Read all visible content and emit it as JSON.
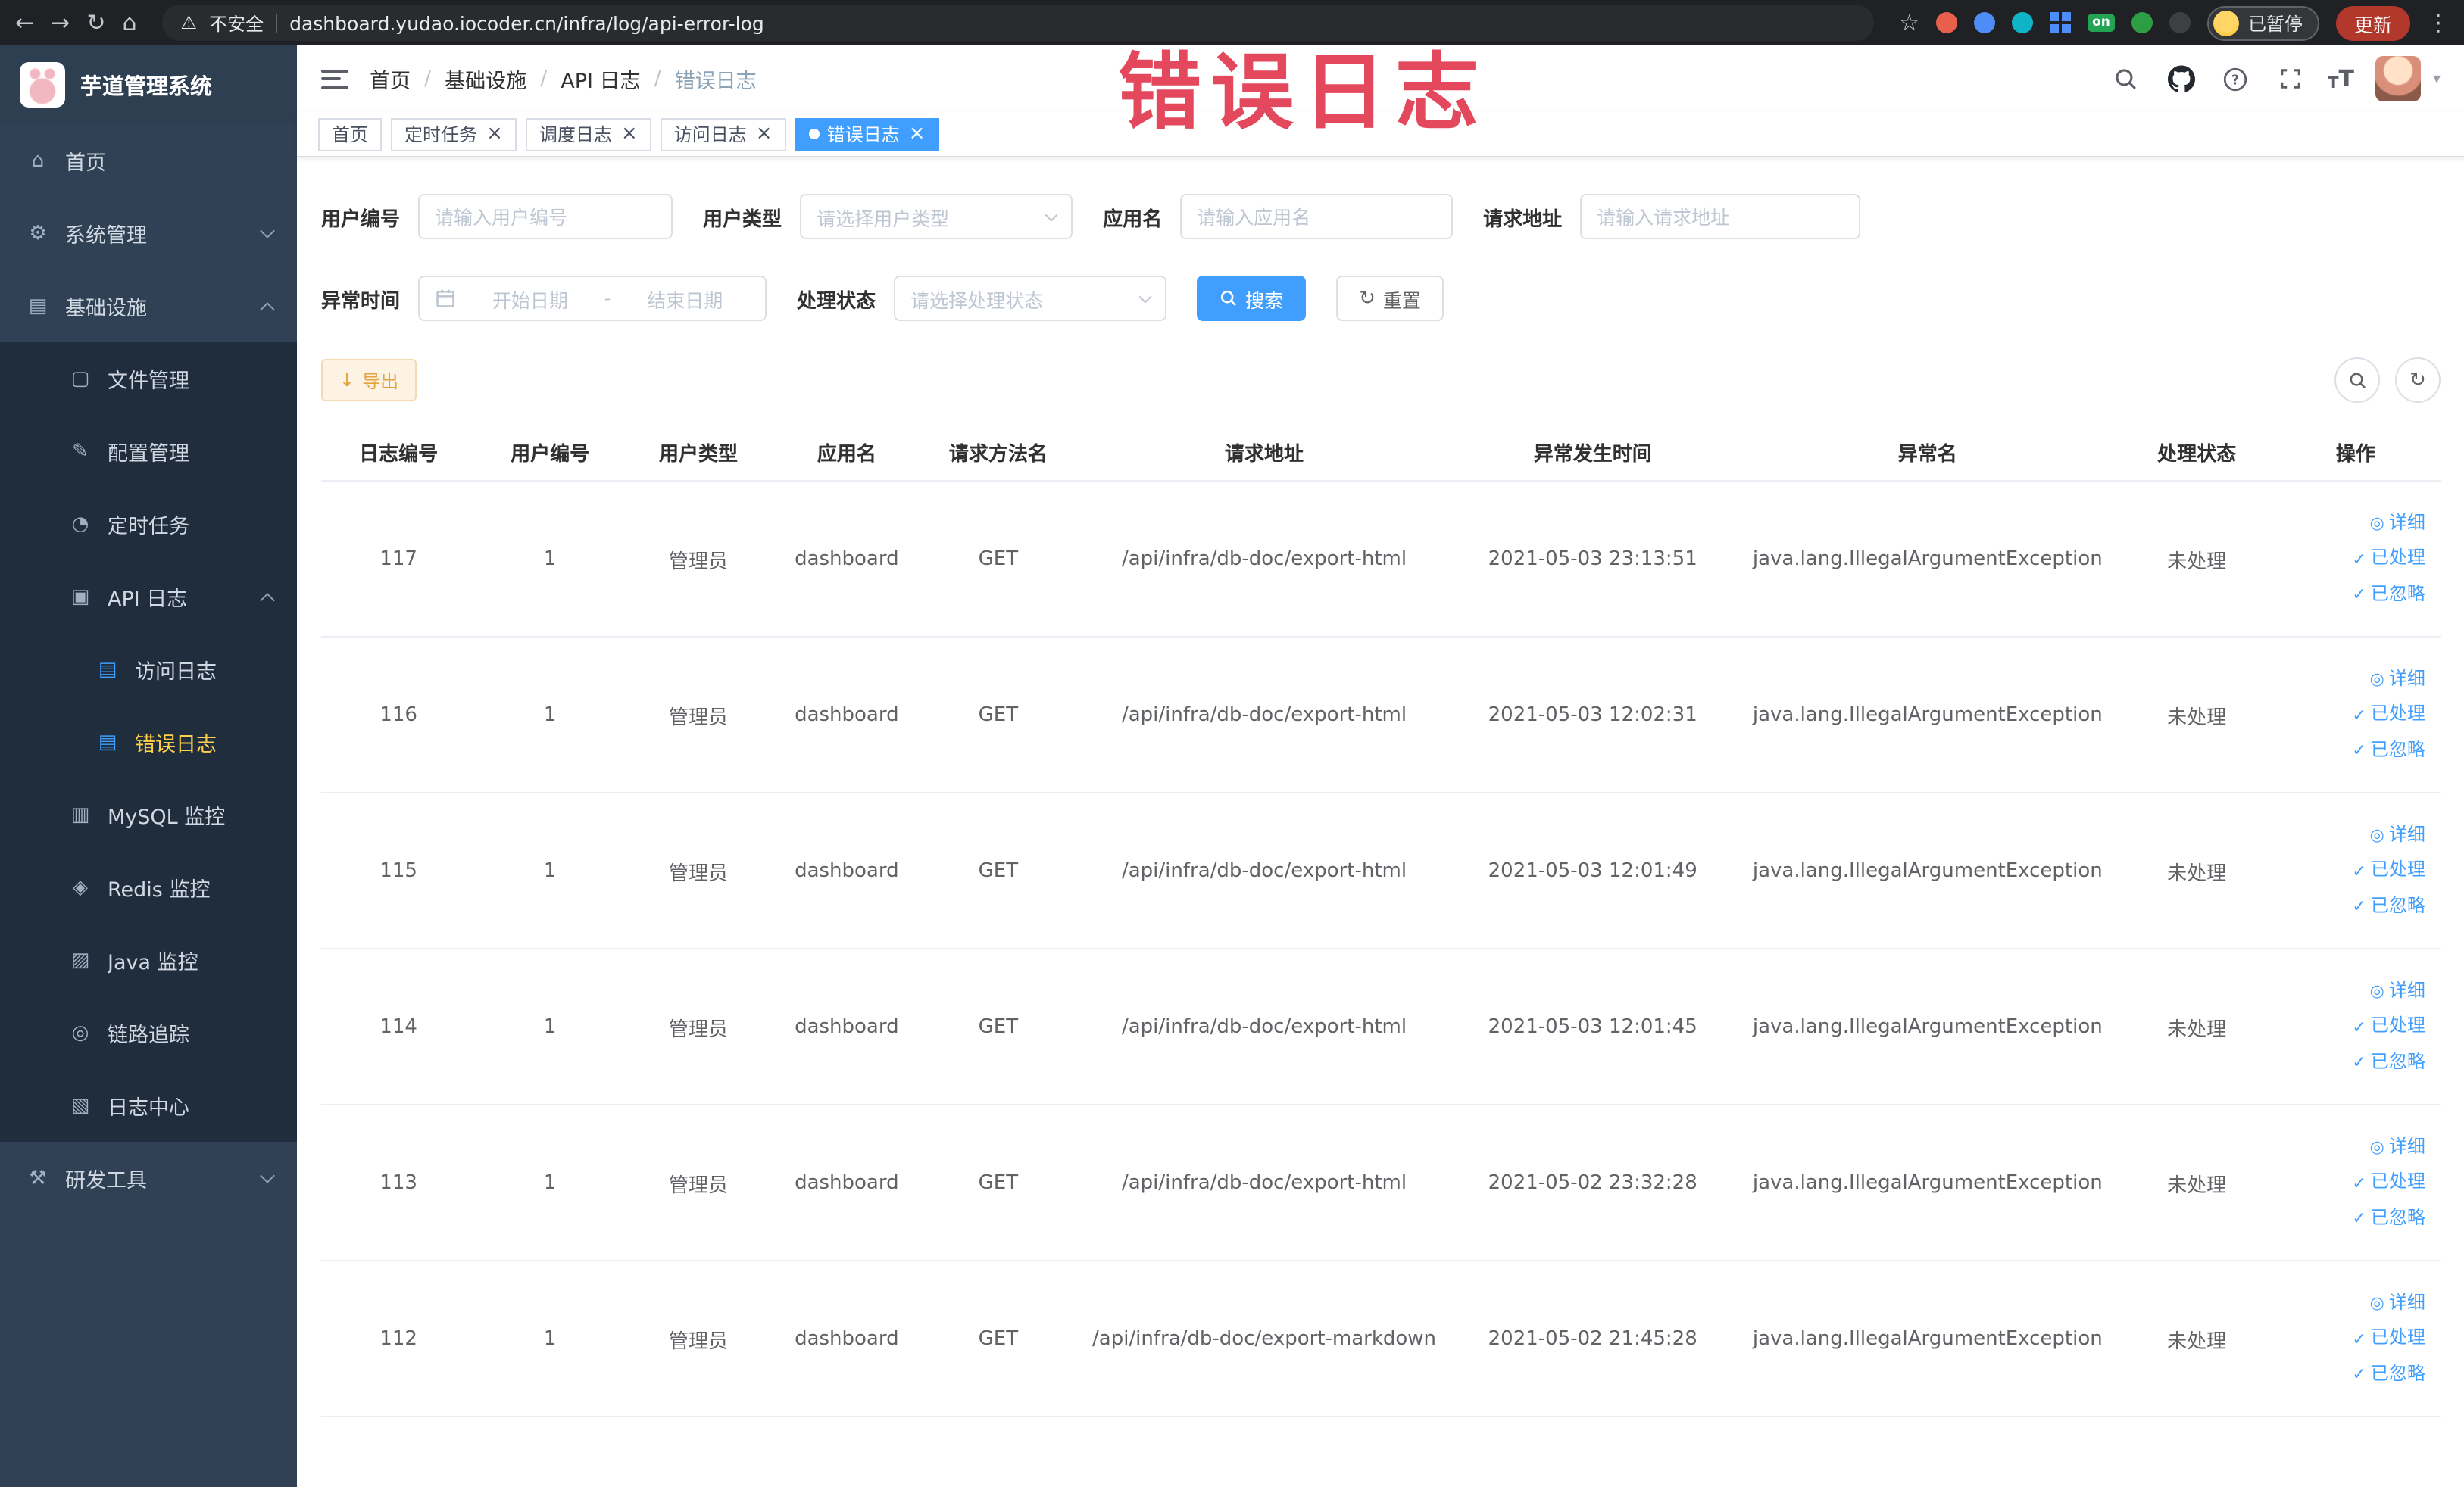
{
  "annotation": {
    "text": "错误日志"
  },
  "browser": {
    "security_label": "不安全",
    "url": "dashboard.yudao.iocoder.cn/infra/log/api-error-log",
    "paused_badge": "已暂停",
    "update_label": "更新",
    "on_badge": "on"
  },
  "sidebar": {
    "app_title": "芋道管理系统",
    "items": [
      {
        "key": "home",
        "label": "首页",
        "icon": "home-icon",
        "glyph": "⌂",
        "depth": 0
      },
      {
        "key": "system-management",
        "label": "系统管理",
        "icon": "gear-icon",
        "glyph": "⚙",
        "depth": 0,
        "arrow": "down"
      },
      {
        "key": "infrastructure",
        "label": "基础设施",
        "icon": "infrastructure-icon",
        "glyph": "▤",
        "depth": 0,
        "arrow": "up"
      },
      {
        "key": "file-management",
        "label": "文件管理",
        "icon": "file-icon",
        "glyph": "▢",
        "depth": 1
      },
      {
        "key": "config-management",
        "label": "配置管理",
        "icon": "edit-icon",
        "glyph": "✎",
        "depth": 1
      },
      {
        "key": "scheduled-tasks",
        "label": "定时任务",
        "icon": "timer-icon",
        "glyph": "◔",
        "depth": 1
      },
      {
        "key": "api-logs",
        "label": "API 日志",
        "icon": "api-log-icon",
        "glyph": "▣",
        "depth": 1,
        "arrow": "up"
      },
      {
        "key": "access-log",
        "label": "访问日志",
        "icon": "document-icon",
        "glyph": "▤",
        "depth": 2,
        "icon_color": "#409eff"
      },
      {
        "key": "error-log",
        "label": "错误日志",
        "icon": "document-icon",
        "glyph": "▤",
        "depth": 2,
        "icon_color": "#409eff",
        "active": true
      },
      {
        "key": "mysql-monitor",
        "label": "MySQL 监控",
        "icon": "mysql-icon",
        "glyph": "▥",
        "depth": 1
      },
      {
        "key": "redis-monitor",
        "label": "Redis 监控",
        "icon": "redis-icon",
        "glyph": "◈",
        "depth": 1
      },
      {
        "key": "java-monitor",
        "label": "Java 监控",
        "icon": "java-icon",
        "glyph": "▨",
        "depth": 1
      },
      {
        "key": "link-tracing",
        "label": "链路追踪",
        "icon": "trace-icon",
        "glyph": "◎",
        "depth": 1
      },
      {
        "key": "log-center",
        "label": "日志中心",
        "icon": "log-center-icon",
        "glyph": "▧",
        "depth": 1
      },
      {
        "key": "dev-tools",
        "label": "研发工具",
        "icon": "tools-icon",
        "glyph": "⚒",
        "depth": 0,
        "arrow": "down"
      }
    ]
  },
  "header": {
    "breadcrumb": [
      "首页",
      "基础设施",
      "API 日志",
      "错误日志"
    ]
  },
  "tabs": [
    {
      "key": "home",
      "label": "首页",
      "closable": false,
      "active": false
    },
    {
      "key": "scheduled-tasks",
      "label": "定时任务",
      "closable": true,
      "active": false
    },
    {
      "key": "job-log",
      "label": "调度日志",
      "closable": true,
      "active": false
    },
    {
      "key": "access-log",
      "label": "访问日志",
      "closable": true,
      "active": false
    },
    {
      "key": "error-log",
      "label": "错误日志",
      "closable": true,
      "active": true
    }
  ],
  "filters": {
    "user_id": {
      "label": "用户编号",
      "placeholder": "请输入用户编号"
    },
    "user_type": {
      "label": "用户类型",
      "placeholder": "请选择用户类型"
    },
    "app_name": {
      "label": "应用名",
      "placeholder": "请输入应用名"
    },
    "request_url": {
      "label": "请求地址",
      "placeholder": "请输入请求地址"
    },
    "exception_time": {
      "label": "异常时间",
      "start_placeholder": "开始日期",
      "separator": "-",
      "end_placeholder": "结束日期"
    },
    "process_status": {
      "label": "处理状态",
      "placeholder": "请选择处理状态"
    },
    "search_label": "搜索",
    "reset_label": "重置"
  },
  "toolbar": {
    "export_label": "导出"
  },
  "table": {
    "columns": [
      "日志编号",
      "用户编号",
      "用户类型",
      "应用名",
      "请求方法名",
      "请求地址",
      "异常发生时间",
      "异常名",
      "处理状态",
      "操作"
    ],
    "actions": [
      {
        "name": "detail-link",
        "label": "详细",
        "icon": "eye-icon",
        "glyph": "◎"
      },
      {
        "name": "mark-processed-link",
        "label": "已处理",
        "icon": "check-icon",
        "glyph": "✓"
      },
      {
        "name": "mark-ignored-link",
        "label": "已忽略",
        "icon": "check-icon",
        "glyph": "✓"
      }
    ],
    "rows": [
      {
        "id": "117",
        "user_id": "1",
        "user_type": "管理员",
        "app": "dashboard",
        "method": "GET",
        "url": "/api/infra/db-doc/export-html",
        "time": "2021-05-03 23:13:51",
        "exception": "java.lang.IllegalArgumentException",
        "status": "未处理"
      },
      {
        "id": "116",
        "user_id": "1",
        "user_type": "管理员",
        "app": "dashboard",
        "method": "GET",
        "url": "/api/infra/db-doc/export-html",
        "time": "2021-05-03 12:02:31",
        "exception": "java.lang.IllegalArgumentException",
        "status": "未处理"
      },
      {
        "id": "115",
        "user_id": "1",
        "user_type": "管理员",
        "app": "dashboard",
        "method": "GET",
        "url": "/api/infra/db-doc/export-html",
        "time": "2021-05-03 12:01:49",
        "exception": "java.lang.IllegalArgumentException",
        "status": "未处理"
      },
      {
        "id": "114",
        "user_id": "1",
        "user_type": "管理员",
        "app": "dashboard",
        "method": "GET",
        "url": "/api/infra/db-doc/export-html",
        "time": "2021-05-03 12:01:45",
        "exception": "java.lang.IllegalArgumentException",
        "status": "未处理"
      },
      {
        "id": "113",
        "user_id": "1",
        "user_type": "管理员",
        "app": "dashboard",
        "method": "GET",
        "url": "/api/infra/db-doc/export-html",
        "time": "2021-05-02 23:32:28",
        "exception": "java.lang.IllegalArgumentException",
        "status": "未处理"
      },
      {
        "id": "112",
        "user_id": "1",
        "user_type": "管理员",
        "app": "dashboard",
        "method": "GET",
        "url": "/api/infra/db-doc/export-markdown",
        "time": "2021-05-02 21:45:28",
        "exception": "java.lang.IllegalArgumentException",
        "status": "未处理"
      }
    ]
  }
}
